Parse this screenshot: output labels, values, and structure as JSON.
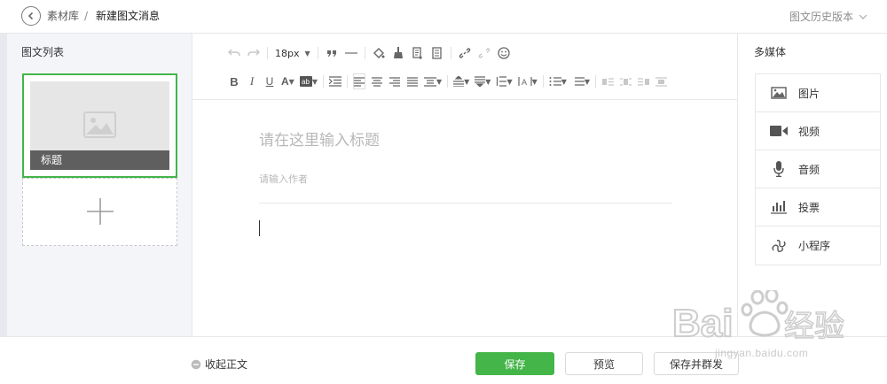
{
  "header": {
    "breadcrumb_root": "素材库",
    "breadcrumb_sep": "/",
    "breadcrumb_current": "新建图文消息",
    "history_label": "图文历史版本"
  },
  "left_panel": {
    "title": "图文列表",
    "articles": [
      {
        "caption": "标题",
        "selected": true
      }
    ]
  },
  "toolbar": {
    "font_size": "18px"
  },
  "editor": {
    "title_placeholder": "请在这里输入标题",
    "author_placeholder": "请输入作者"
  },
  "right_panel": {
    "title": "多媒体",
    "items": [
      {
        "label": "图片",
        "icon": "image-icon"
      },
      {
        "label": "视频",
        "icon": "video-icon"
      },
      {
        "label": "音频",
        "icon": "microphone-icon"
      },
      {
        "label": "投票",
        "icon": "vote-icon"
      },
      {
        "label": "小程序",
        "icon": "mini-program-icon"
      }
    ]
  },
  "footer": {
    "collapse_label": "收起正文",
    "save_label": "保存",
    "preview_label": "预览",
    "publish_label": "保存并群发"
  },
  "watermark": {
    "url": "jingyan.baidu.com"
  },
  "colors": {
    "accent": "#44b549",
    "border": "#e7e7eb",
    "panel_bg": "#f4f5f9"
  }
}
